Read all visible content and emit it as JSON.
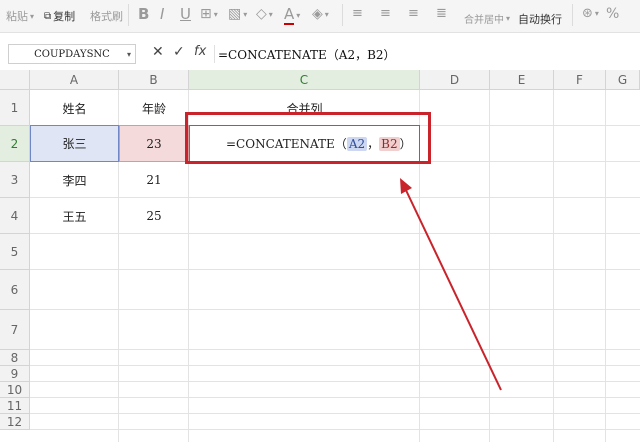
{
  "ribbon": {
    "paste": "粘贴",
    "copy": "复制",
    "format_painter": "格式刷",
    "bold": "B",
    "italic": "I",
    "underline": "U",
    "font_color": "A",
    "merge_center": "合并居中",
    "wrap_text": "自动换行",
    "percent": "%"
  },
  "formula_bar": {
    "name_box": "COUPDAYSNC",
    "cancel": "✕",
    "confirm": "✓",
    "fx": "fx",
    "formula": "=CONCATENATE（A2，B2）"
  },
  "columns": [
    "A",
    "B",
    "C",
    "D",
    "E",
    "F",
    "G"
  ],
  "rows": [
    "1",
    "2",
    "3",
    "4",
    "5",
    "6",
    "7",
    "8",
    "9",
    "10",
    "11",
    "12"
  ],
  "cells": {
    "A1": "姓名",
    "B1": "年龄",
    "C1": "合并列",
    "A2": "张三",
    "B2": "23",
    "A3": "李四",
    "B3": "21",
    "A4": "王五",
    "B4": "25"
  },
  "c2_formula": {
    "prefix": "=CONCATENATE（",
    "ref_a": "A2",
    "comma": "，",
    "ref_b": "B2",
    "suffix": "）"
  },
  "colors": {
    "selected_green": "#3f8f3f",
    "ref_a_blue": "#6f86c8",
    "ref_b_red": "#d59a9a",
    "annotation_red": "#c9232b"
  }
}
